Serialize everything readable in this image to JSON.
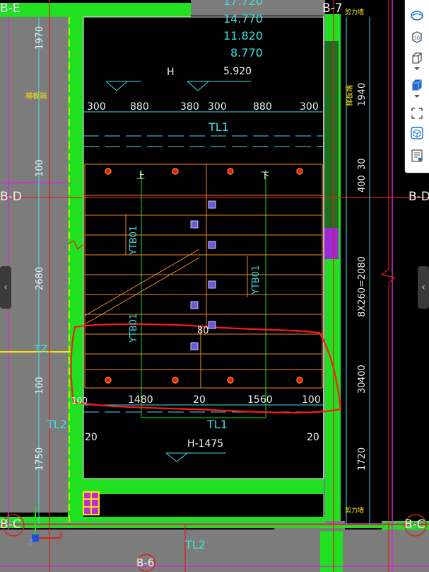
{
  "axes": {
    "top_left": "B-E",
    "top_right": "B-7",
    "mid_left": "B-D",
    "mid_right": "B-D",
    "bottom_left": "B-C",
    "bottom_right": "B-C",
    "bottom_center": "B-6"
  },
  "elevations": [
    "17.720",
    "14.770",
    "11.820",
    "8.770",
    "5.920"
  ],
  "landing_top_label": "H",
  "landing_bottom_label": "H-1475",
  "beam_labels": {
    "top": "TL1",
    "middle": "TL1",
    "left": "TL2",
    "bottom": "TL2"
  },
  "top_dims": [
    "300",
    "880",
    "380",
    "300",
    "880",
    "300"
  ],
  "bottom_dims": [
    "100",
    "1480",
    "20",
    "1560",
    "100"
  ],
  "left_dims": [
    "1970",
    "100",
    "2680",
    "100",
    "1750"
  ],
  "right_dims": [
    "1940",
    "400",
    "30",
    "8X260=2080",
    "30",
    "400",
    "1720"
  ],
  "wall_labels": {
    "left": "梯板端",
    "right": "梯板端",
    "right_top": "剪力墙",
    "right_bottom": "剪力墙"
  },
  "slab_labels": [
    "YTB01",
    "YTB01",
    "YTB01"
  ],
  "stair_marks": {
    "up_left": "上",
    "up_right": "下"
  },
  "small_dims": {
    "gap": "80",
    "left20": "20",
    "right20": "20",
    "tz": "TZ"
  },
  "ucs": {
    "y": "Y",
    "x": "X",
    "z": "Z"
  },
  "colors": {
    "wall_green": "#21e021",
    "wall_gray": "#8a8a8a",
    "beam_dash": "#3fe0e6",
    "stair_orange": "#f08a1c",
    "grid_red": "#e11b1b",
    "markup_red": "#ff1a1a",
    "magenta": "#d62ad6",
    "purple": "#9c2bd6"
  },
  "toolbar": {
    "items": [
      {
        "icon": "sphere-view-icon"
      },
      {
        "icon": "3d-view-icon",
        "text": "3D"
      },
      {
        "icon": "box-view-icon"
      },
      {
        "icon": "chevron-down-icon"
      },
      {
        "icon": "solid-cube-icon"
      },
      {
        "icon": "chevron-down-icon"
      },
      {
        "icon": "fullscreen-icon"
      },
      {
        "icon": "isometric-cube-icon"
      },
      {
        "icon": "properties-icon"
      }
    ]
  },
  "side_handles": {
    "left": "‹",
    "right": "‹"
  }
}
